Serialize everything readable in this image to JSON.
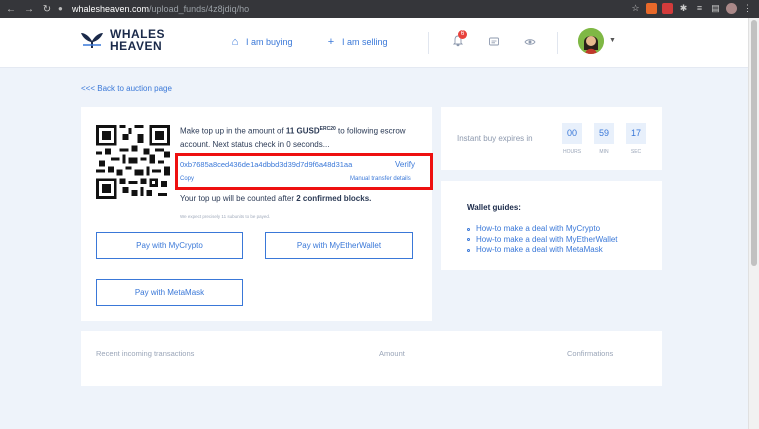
{
  "browser": {
    "url_host": "whalesheaven.com",
    "url_path": "/upload_funds/4z8jdiq/ho"
  },
  "header": {
    "logo_line1": "WHALES",
    "logo_line2": "HEAVEN",
    "nav_buying": "I am buying",
    "nav_selling": "I am selling",
    "notification_count": "6"
  },
  "back_link": "<<< Back to auction page",
  "topup": {
    "prefix": "Make top up in the amount of ",
    "amount": "11 GUSD",
    "amount_sup": "ERC20",
    "suffix": " to following escrow account. Next status check in 0 seconds..."
  },
  "escrow": {
    "address": "0xb7685a8ced436de1a4dbbd3d39d7d9f6a48d31aa",
    "verify_label": "Verify",
    "copy_label": "Copy",
    "manual_label": "Manual transfer details"
  },
  "confirm": {
    "prefix": "Your top up will be counted after ",
    "count": "2 confirmed blocks."
  },
  "tiny_note": "We expect precisely 11 subunits to be payed.",
  "buttons": {
    "mycrypto": "Pay with MyCrypto",
    "myetherwallet": "Pay with MyEtherWallet",
    "metamask": "Pay with MetaMask"
  },
  "timer": {
    "label": "Instant buy expires in",
    "hours": "00",
    "minutes": "59",
    "seconds": "17",
    "hours_unit": "HOURS",
    "min_unit": "MIN",
    "sec_unit": "SEC"
  },
  "guides": {
    "title": "Wallet guides:",
    "items": [
      "How-to make a deal with MyCrypto",
      "How-to make a deal with MyEtherWallet",
      "How-to make a deal with MetaMask"
    ]
  },
  "transactions": {
    "col_recent": "Recent incoming transactions",
    "col_amount": "Amount",
    "col_confirmations": "Confirmations"
  },
  "colors": {
    "accent": "#3a78d8",
    "highlight": "#ee1010",
    "background": "#eef3fa"
  }
}
